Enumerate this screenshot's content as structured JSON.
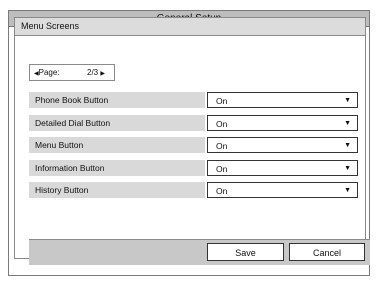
{
  "window": {
    "title": "General Setup"
  },
  "section": {
    "title": "Menu Screens"
  },
  "pager": {
    "label": "Page:",
    "value": "2/3",
    "prev_icon": "triangle-left-icon",
    "next_icon": "triangle-right-icon"
  },
  "settings": [
    {
      "label": "Phone Book Button",
      "value": "On"
    },
    {
      "label": "Detailed Dial Button",
      "value": "On"
    },
    {
      "label": "Menu Button",
      "value": "On"
    },
    {
      "label": "Information Button",
      "value": "On"
    },
    {
      "label": "History Button",
      "value": "On"
    }
  ],
  "buttons": {
    "save": "Save",
    "cancel": "Cancel"
  }
}
